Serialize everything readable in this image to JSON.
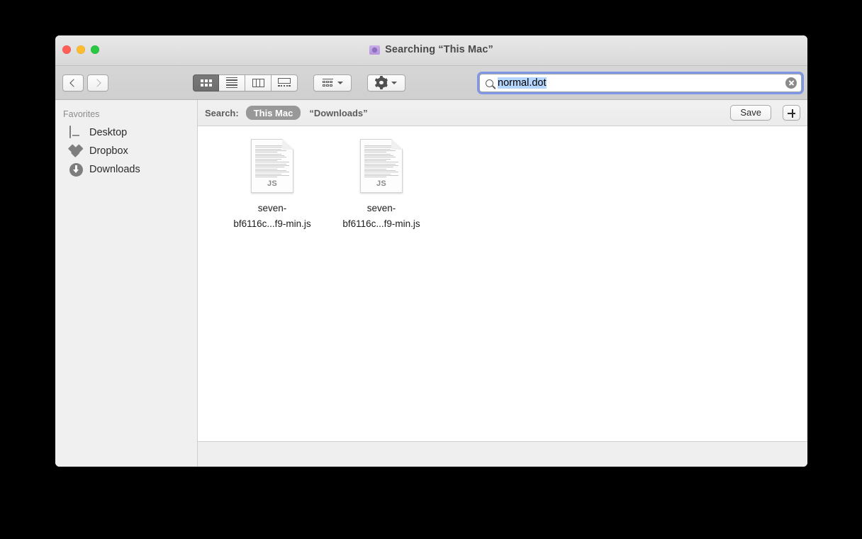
{
  "window": {
    "title": "Searching “This Mac”",
    "title_icon": "smart-folder-icon",
    "traffic_lights": {
      "close": "#ff5f57",
      "minimize": "#febc2e",
      "zoom": "#28c840"
    }
  },
  "toolbar": {
    "back_icon": "chevron-left-icon",
    "forward_icon": "chevron-right-icon",
    "view_modes": [
      {
        "name": "icon-view",
        "icon": "grid-icon",
        "selected": true
      },
      {
        "name": "list-view",
        "icon": "list-icon",
        "selected": false
      },
      {
        "name": "column-view",
        "icon": "columns-icon",
        "selected": false
      },
      {
        "name": "gallery-view",
        "icon": "coverflow-icon",
        "selected": false
      }
    ],
    "arrange_icon": "arrange-icon",
    "action_icon": "gear-icon",
    "dropdown_icon": "chevron-down-icon"
  },
  "search": {
    "icon": "search-icon",
    "value": "normal.dot",
    "selected": true,
    "clear_icon": "clear-circle-icon",
    "focus_ring_color": "#8096e6",
    "selection_color": "#b4d5fe"
  },
  "sidebar": {
    "header": "Favorites",
    "items": [
      {
        "label": "Desktop",
        "icon": "desktop-icon"
      },
      {
        "label": "Dropbox",
        "icon": "dropbox-icon"
      },
      {
        "label": "Downloads",
        "icon": "downloads-icon"
      }
    ]
  },
  "scope_bar": {
    "label": "Search:",
    "options": [
      {
        "label": "This Mac",
        "selected": true
      },
      {
        "label": "“Downloads”",
        "selected": false
      }
    ],
    "save_label": "Save",
    "add_icon": "plus-icon"
  },
  "files": [
    {
      "name_line1": "seven-",
      "name_line2": "bf6116c...f9-min.js",
      "icon": "js-document-icon",
      "badge": "JS"
    },
    {
      "name_line1": "seven-",
      "name_line2": "bf6116c...f9-min.js",
      "icon": "js-document-icon",
      "badge": "JS"
    }
  ]
}
